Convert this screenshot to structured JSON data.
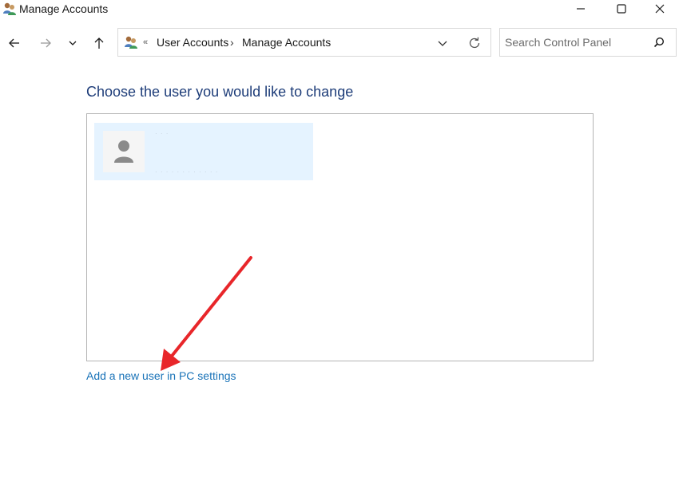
{
  "window": {
    "title": "Manage Accounts",
    "app_icon": "user-accounts-icon",
    "controls": [
      "minimize-icon",
      "maximize-icon",
      "close-icon"
    ]
  },
  "nav": {
    "back_icon": "arrow-left-icon",
    "forward_icon": "arrow-right-icon",
    "recent_icon": "chevron-down-icon",
    "up_icon": "arrow-up-icon"
  },
  "address": {
    "overflow": "«",
    "crumbs": [
      "User Accounts",
      "Manage Accounts"
    ],
    "separator": "›",
    "dropdown_icon": "chevron-down-icon",
    "refresh_icon": "refresh-icon"
  },
  "search": {
    "placeholder": "Search Control Panel",
    "value": "",
    "icon": "search-icon"
  },
  "main": {
    "heading": "Choose the user you would like to change",
    "users": [
      {
        "avatar_icon": "user-avatar-icon",
        "name": "· · ·",
        "detail": "· · · · · · · · · · · ·"
      }
    ],
    "add_user_link": "Add a new user in PC settings"
  },
  "colors": {
    "heading": "#1e3d79",
    "link": "#1a73b8",
    "tile_selected": "#e5f3ff",
    "annotation_arrow": "#e8262a"
  }
}
